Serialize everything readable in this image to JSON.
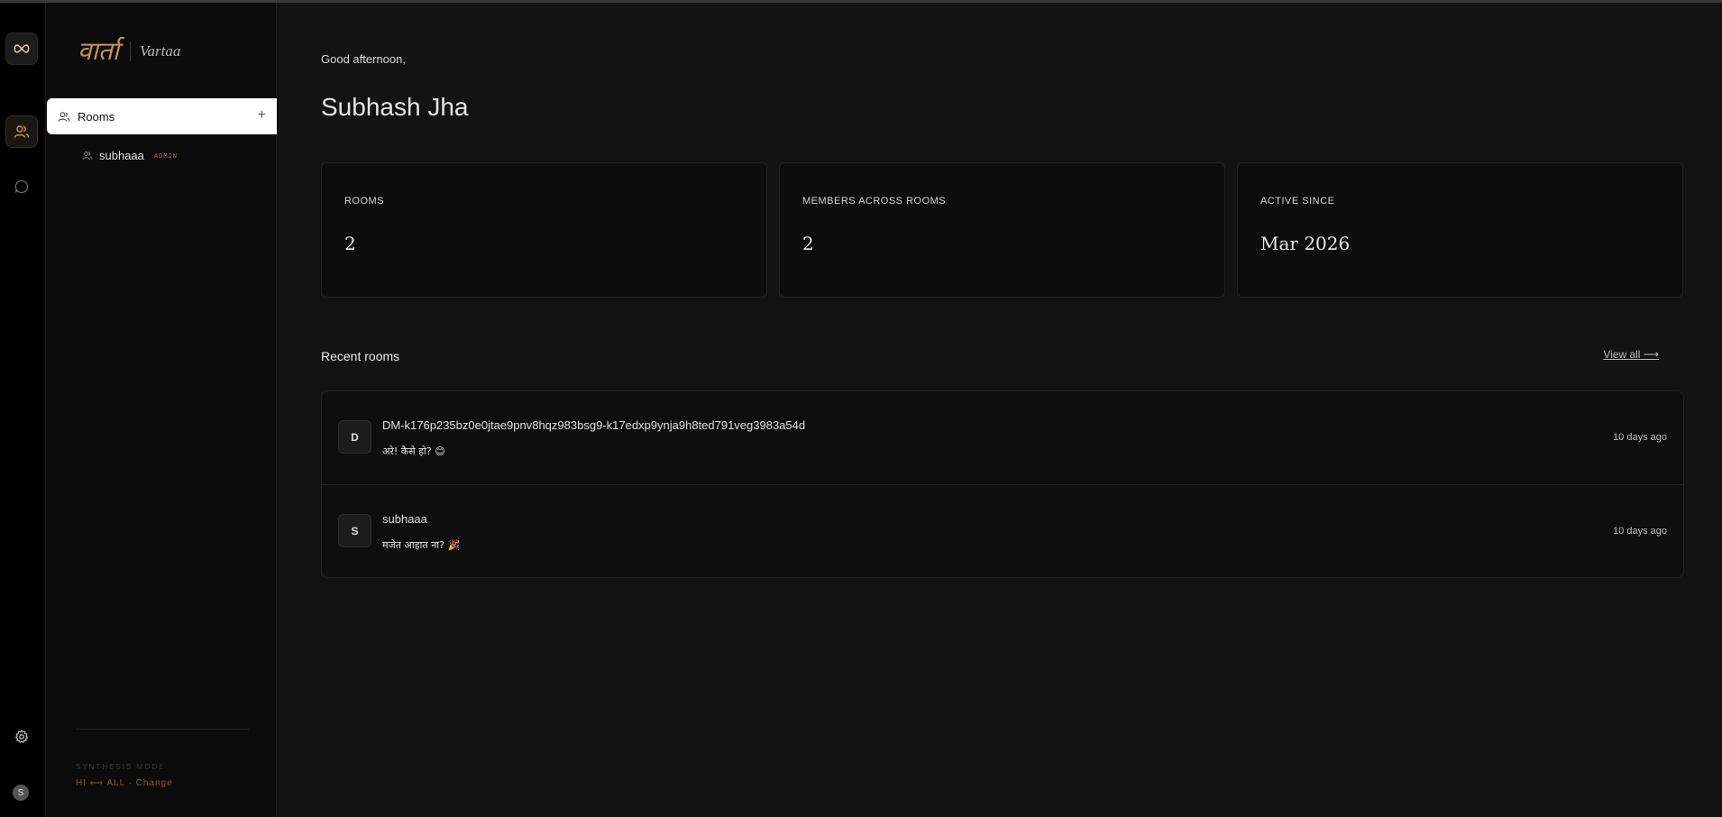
{
  "brand": {
    "devanagari": "वार्ता",
    "latin": "Vartaa"
  },
  "rail": {
    "logo_icon": "infinity-icon",
    "rooms_icon": "users-icon",
    "chat_icon": "chat-bubble-icon",
    "settings_icon": "gear-icon",
    "avatar_initial": "S"
  },
  "sidebar": {
    "rooms_label": "Rooms",
    "add_symbol": "+",
    "rooms": [
      {
        "name": "subhaaa",
        "badge": "ADMIN"
      }
    ],
    "synthesis_label": "SYNTHESIS MODE",
    "synthesis_value": "HI ⟷ ALL · Change"
  },
  "main": {
    "greeting": "Good afternoon,",
    "user_name": "Subhash Jha",
    "stats": [
      {
        "label": "ROOMS",
        "value": "2"
      },
      {
        "label": "MEMBERS ACROSS ROOMS",
        "value": "2"
      },
      {
        "label": "ACTIVE SINCE",
        "value": "Mar 2026"
      }
    ],
    "recent_title": "Recent rooms",
    "view_all": "View all ⟶",
    "recent_rooms": [
      {
        "initial": "D",
        "name": "DM-k176p235bz0e0jtae9pnv8hqz983bsg9-k17edxp9ynja9h8ted791veg3983a54d",
        "last_message": "अरे! कैसे हो? 😊",
        "time": "10 days ago"
      },
      {
        "initial": "S",
        "name": "subhaaa",
        "last_message": "मजेत आहात ना? 🎉",
        "time": "10 days ago"
      }
    ]
  },
  "colors": {
    "accent": "#c8964e",
    "background": "#131313",
    "sidebar": "#0b0b0b",
    "rail": "#000000"
  }
}
